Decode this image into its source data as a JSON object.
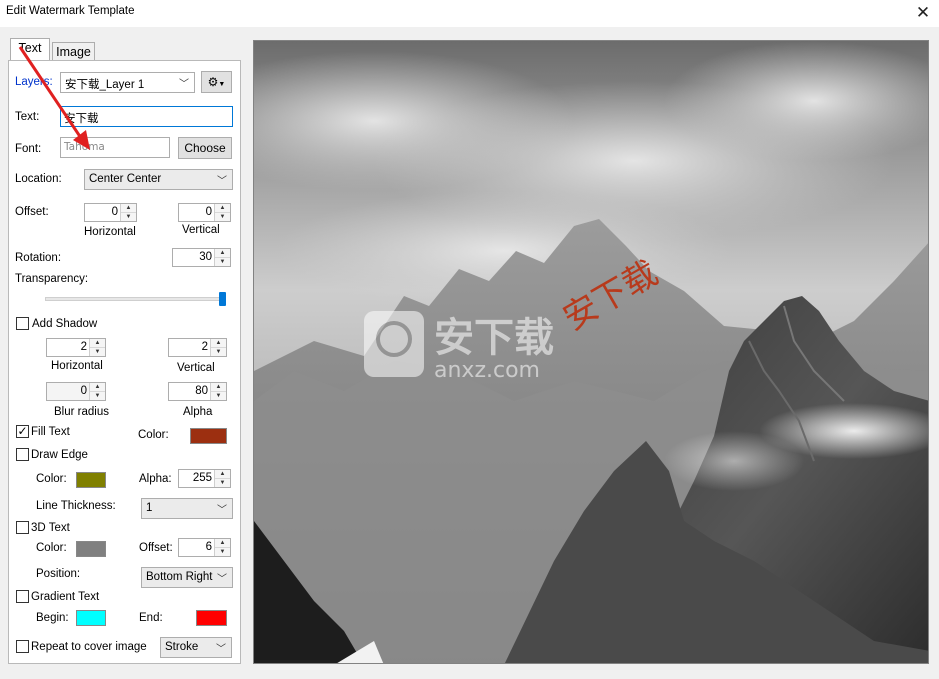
{
  "window": {
    "title": "Edit Watermark Template"
  },
  "tabs": [
    {
      "label": "Text"
    },
    {
      "label": "Image"
    }
  ],
  "layers": {
    "label": "Layers:",
    "value": "安下载_Layer 1"
  },
  "text_field": {
    "label": "Text:",
    "value": "安下载"
  },
  "font": {
    "label": "Font:",
    "value": "Tahoma",
    "choose_label": "Choose"
  },
  "location": {
    "label": "Location:",
    "value": "Center Center"
  },
  "offset": {
    "label": "Offset:",
    "horizontal_value": "0",
    "horizontal_label": "Horizontal",
    "vertical_value": "0",
    "vertical_label": "Vertical"
  },
  "rotation": {
    "label": "Rotation:",
    "value": "30"
  },
  "transparency": {
    "label": "Transparency:",
    "level": 1.0
  },
  "shadow": {
    "label": "Add Shadow",
    "checked": false,
    "horizontal_value": "2",
    "horizontal_label": "Horizontal",
    "vertical_value": "2",
    "vertical_label": "Vertical",
    "blur_value": "0",
    "blur_label": "Blur radius",
    "alpha_value": "80",
    "alpha_label": "Alpha"
  },
  "fill_text": {
    "label": "Fill Text",
    "checked": true,
    "check_mark": "✓",
    "color_label": "Color:",
    "color": "#9c2f10"
  },
  "draw_edge": {
    "label": "Draw Edge",
    "checked": false,
    "color_label": "Color:",
    "color": "#808000",
    "alpha_label": "Alpha:",
    "alpha_value": "255",
    "thickness_label": "Line Thickness:",
    "thickness_value": "1"
  },
  "text_3d": {
    "label": "3D Text",
    "checked": false,
    "color_label": "Color:",
    "color": "#808080",
    "offset_label": "Offset:",
    "offset_value": "6",
    "position_label": "Position:",
    "position_value": "Bottom Right"
  },
  "gradient": {
    "label": "Gradient Text",
    "checked": false,
    "begin_label": "Begin:",
    "begin_color": "#00ffff",
    "end_label": "End:",
    "end_color": "#ff0000"
  },
  "repeat": {
    "label": "Repeat to cover image",
    "checked": false,
    "mode_value": "Stroke"
  },
  "preview": {
    "watermark_text": "安下载",
    "logo_text_cn": "安下载",
    "logo_text_url": "anxz.com",
    "watermark_color": "#b83a1c",
    "annotation_color": "#e02020"
  },
  "icons": {
    "close": "close-icon",
    "gear": "gear-icon",
    "dropdown": "chevron-down-icon",
    "arrow": "red-annotation-arrow"
  }
}
